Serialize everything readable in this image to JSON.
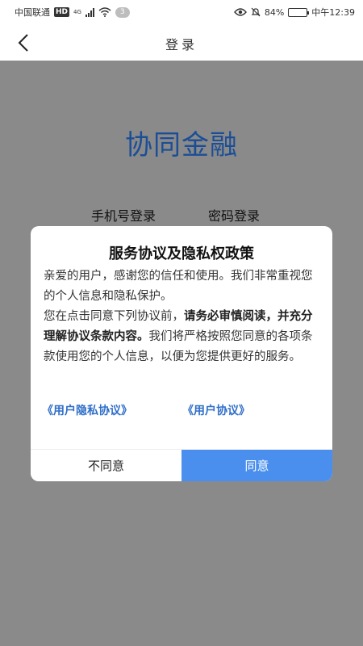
{
  "status_bar": {
    "carrier": "中国联通",
    "hd": "HD",
    "network": "4G",
    "notification_count": "3",
    "battery": "84%",
    "battery_level": 0.84,
    "time": "中午12:39"
  },
  "nav": {
    "title": "登录"
  },
  "login": {
    "app_title": "协同金融",
    "tabs": [
      "手机号登录",
      "密码登录"
    ]
  },
  "dialog": {
    "title": "服务协议及隐私权政策",
    "p1": "亲爱的用户，感谢您的信任和使用。我们非常重视您的个人信息和隐私保护。",
    "p2_before": "您在点击同意下列协议前，",
    "p2_bold": "请务必审慎阅读，并充分理解协议条款内容。",
    "p2_after": "我们将严格按照您同意的各项条款使用您的个人信息，以便为您提供更好的服务。",
    "links": {
      "privacy": "《用户隐私协议》",
      "user": "《用户协议》"
    },
    "buttons": {
      "disagree": "不同意",
      "agree": "同意"
    }
  },
  "colors": {
    "accent": "#4a8fed",
    "link": "#2f6ec9",
    "title_blue": "#1b4e96",
    "overlay": "#8a8a8a"
  }
}
